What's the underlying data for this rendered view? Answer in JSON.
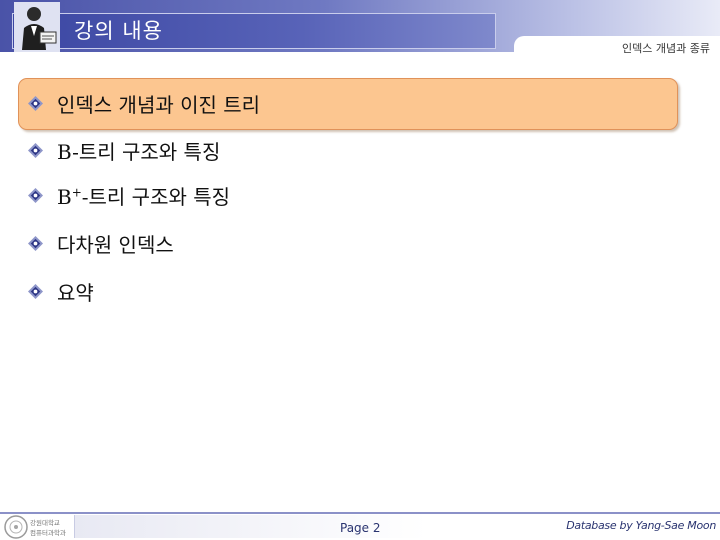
{
  "header": {
    "title": "강의 내용",
    "subtitle": "인덱스 개념과 종류"
  },
  "bullets": [
    {
      "label": "인덱스 개념과 이진 트리",
      "highlighted": true
    },
    {
      "label": "B-트리 구조와 특징",
      "highlighted": false
    },
    {
      "label_prefix": "B",
      "label_sup": "+",
      "label_rest": "-트리 구조와 특징",
      "highlighted": false
    },
    {
      "label": "다차원 인덱스",
      "highlighted": false
    },
    {
      "label": "요약",
      "highlighted": false
    }
  ],
  "footer": {
    "logo_text_1": "강원대학교",
    "logo_text_2": "컴퓨터과학과",
    "page_label": "Page 2",
    "credit": "Database by Yang-Sae Moon"
  },
  "colors": {
    "header_blue": "#4a53a8",
    "highlight_fill": "#fcc690",
    "highlight_border": "#e0925a",
    "footer_text": "#2a3470"
  }
}
